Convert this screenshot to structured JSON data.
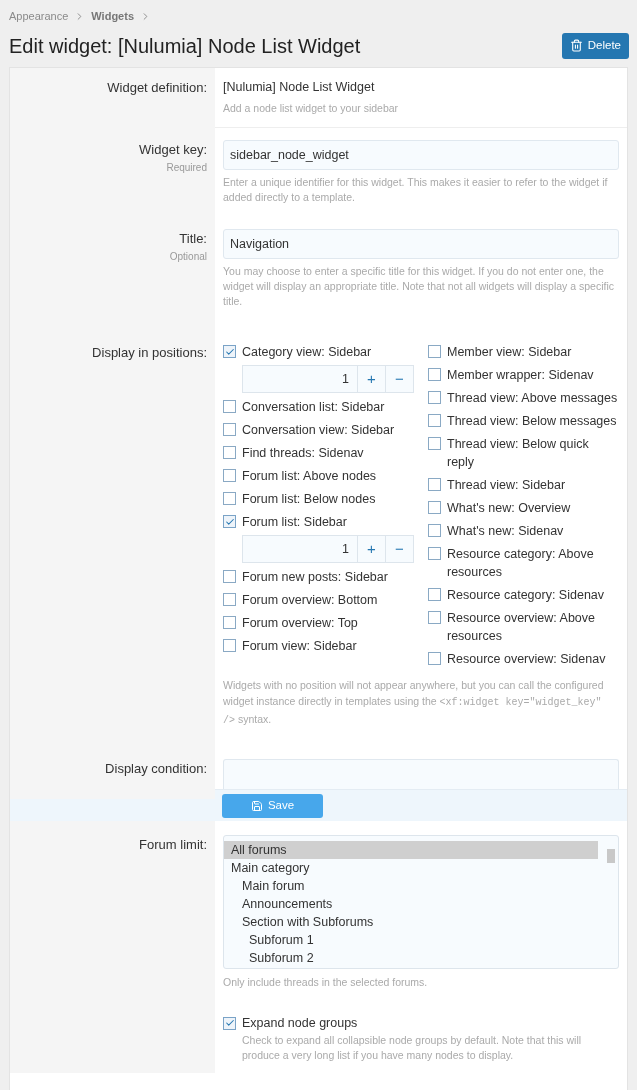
{
  "breadcrumbs": [
    "Appearance",
    "Widgets"
  ],
  "title": "Edit widget: [Nulumia] Node List Widget",
  "delete_button": "Delete",
  "definition": {
    "label": "Widget definition:",
    "value": "[Nulumia] Node List Widget",
    "hint": "Add a node list widget to your sidebar"
  },
  "widget_key": {
    "label": "Widget key:",
    "sublabel": "Required",
    "value": "sidebar_node_widget",
    "hint": "Enter a unique identifier for this widget. This makes it easier to refer to the widget if added directly to a template."
  },
  "title_field": {
    "label": "Title:",
    "sublabel": "Optional",
    "value": "Navigation",
    "hint": "You may choose to enter a specific title for this widget. If you do not enter one, the widget will display an appropriate title. Note that not all widgets will display a specific title."
  },
  "positions": {
    "label": "Display in positions:",
    "columns": [
      [
        {
          "label": "Category view: Sidebar",
          "checked": true,
          "order": "1",
          "plus": "+",
          "minus": "−"
        },
        {
          "label": "Conversation list: Sidebar",
          "checked": false
        },
        {
          "label": "Conversation view: Sidebar",
          "checked": false
        },
        {
          "label": "Find threads: Sidenav",
          "checked": false
        },
        {
          "label": "Forum list: Above nodes",
          "checked": false
        },
        {
          "label": "Forum list: Below nodes",
          "checked": false
        },
        {
          "label": "Forum list: Sidebar",
          "checked": true,
          "order": "1",
          "plus": "+",
          "minus": "−"
        },
        {
          "label": "Forum new posts: Sidebar",
          "checked": false
        },
        {
          "label": "Forum overview: Bottom",
          "checked": false
        },
        {
          "label": "Forum overview: Top",
          "checked": false
        },
        {
          "label": "Forum view: Sidebar",
          "checked": false
        }
      ],
      [
        {
          "label": "Member view: Sidebar",
          "checked": false
        },
        {
          "label": "Member wrapper: Sidenav",
          "checked": false
        },
        {
          "label": "Thread view: Above messages",
          "checked": false
        },
        {
          "label": "Thread view: Below messages",
          "checked": false
        },
        {
          "label": "Thread view: Below quick reply",
          "checked": false
        },
        {
          "label": "Thread view: Sidebar",
          "checked": false
        },
        {
          "label": "What's new: Overview",
          "checked": false
        },
        {
          "label": "What's new: Sidenav",
          "checked": false
        },
        {
          "label": "Resource category: Above resources",
          "checked": false
        },
        {
          "label": "Resource category: Sidenav",
          "checked": false
        },
        {
          "label": "Resource overview: Above resources",
          "checked": false
        },
        {
          "label": "Resource overview: Sidenav",
          "checked": false
        }
      ]
    ],
    "hint_before": "Widgets with no position will not appear anywhere, but you can call the configured widget instance directly in templates using the",
    "hint_code": "<xf:widget key=\"widget_key\" />",
    "hint_after": "syntax."
  },
  "display_condition": {
    "label": "Display condition:"
  },
  "save_button": "Save",
  "forum_limit": {
    "label": "Forum limit:",
    "hint": "Only include threads in the selected forums.",
    "options": [
      {
        "label": "All forums",
        "selected": true
      },
      {
        "label": "Main category",
        "selected": false,
        "children": [
          {
            "label": "Main forum",
            "selected": false
          },
          {
            "label": "Announcements",
            "selected": false
          },
          {
            "label": "Section with Subforums",
            "selected": false,
            "children": [
              {
                "label": "Subforum 1",
                "selected": false
              },
              {
                "label": "Subforum 2",
                "selected": false
              }
            ]
          }
        ]
      }
    ]
  },
  "expand": {
    "label": "Expand node groups",
    "checked": true,
    "hint": "Check to expand all collapsible node groups by default. Note that this will produce a very long list if you have many nodes to display."
  }
}
